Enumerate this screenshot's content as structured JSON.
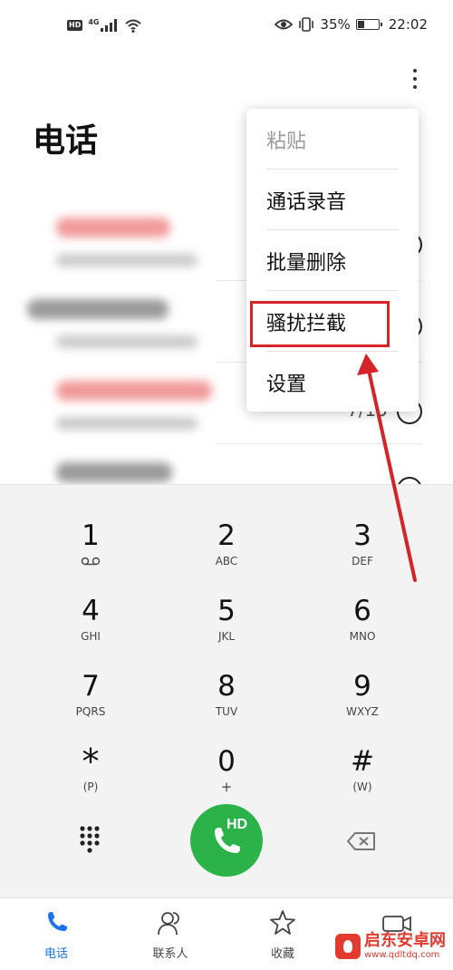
{
  "status_bar": {
    "network": "4G",
    "battery": "35%",
    "battery_level": 0.35,
    "time": "22:02"
  },
  "header": {
    "title": "电话"
  },
  "call_log": {
    "rows": [
      {
        "name_color": "#f19a9a"
      },
      {
        "name_color": "#9a9a9a"
      },
      {
        "name_color": "#f19a9a",
        "time": "7/15"
      },
      {
        "name_color": "#9a9a9a"
      }
    ]
  },
  "menu": {
    "items": [
      {
        "label": "粘贴",
        "enabled": false
      },
      {
        "label": "通话录音",
        "enabled": true
      },
      {
        "label": "批量删除",
        "enabled": true
      },
      {
        "label": "骚扰拦截",
        "enabled": true,
        "highlighted": true
      },
      {
        "label": "设置",
        "enabled": true
      }
    ]
  },
  "annotation": {
    "color": "#d4242a"
  },
  "dialpad": {
    "keys": [
      {
        "digit": "1",
        "letters": ""
      },
      {
        "digit": "2",
        "letters": "ABC"
      },
      {
        "digit": "3",
        "letters": "DEF"
      },
      {
        "digit": "4",
        "letters": "GHI"
      },
      {
        "digit": "5",
        "letters": "JKL"
      },
      {
        "digit": "6",
        "letters": "MNO"
      },
      {
        "digit": "7",
        "letters": "PQRS"
      },
      {
        "digit": "8",
        "letters": "TUV"
      },
      {
        "digit": "9",
        "letters": "WXYZ"
      },
      {
        "digit": "*",
        "letters": "(P)"
      },
      {
        "digit": "0",
        "letters": "+"
      },
      {
        "digit": "#",
        "letters": "(W)"
      }
    ],
    "call_button_badge": "HD",
    "call_color": "#2bb34a"
  },
  "bottom_nav": {
    "items": [
      {
        "label": "电话",
        "icon": "phone-icon",
        "active": true
      },
      {
        "label": "联系人",
        "icon": "contacts-icon",
        "active": false
      },
      {
        "label": "收藏",
        "icon": "star-icon",
        "active": false
      },
      {
        "label": "",
        "icon": "video-call-icon",
        "active": false
      }
    ],
    "accent": "#1a73e8"
  },
  "watermark": {
    "title": "启东安卓网",
    "url": "www.qdltdq.com"
  }
}
